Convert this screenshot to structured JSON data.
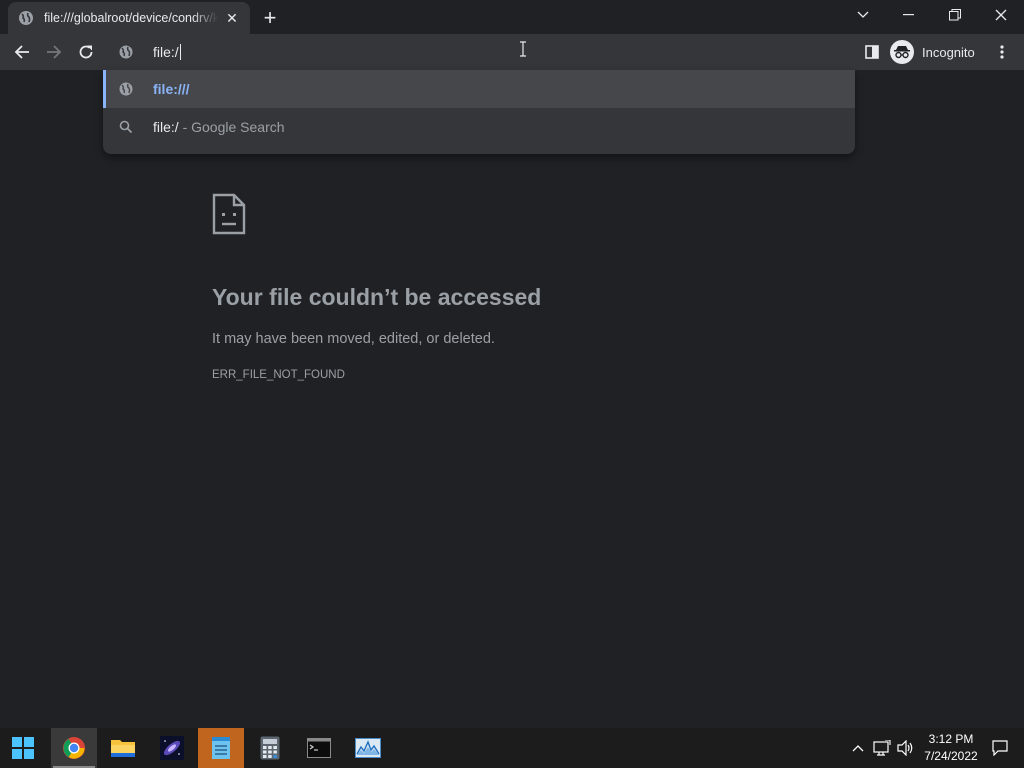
{
  "browser": {
    "tab": {
      "title": "file:///globalroot/device/condrv/kernelconnect"
    },
    "new_tab_symbol": "+",
    "omnibox": {
      "value": "file:/"
    },
    "incognito_label": "Incognito",
    "suggestions": [
      {
        "icon": "globe-icon",
        "main": "file:///",
        "sub": "",
        "selected": true
      },
      {
        "icon": "search-icon",
        "main": "file:/",
        "sub": " - Google Search",
        "selected": false
      }
    ]
  },
  "error_page": {
    "title": "Your file couldn’t be accessed",
    "description": "It may have been moved, edited, or deleted.",
    "code": "ERR_FILE_NOT_FOUND"
  },
  "taskbar": {
    "apps": [
      "start-icon",
      "chrome-icon",
      "file-explorer-icon",
      "galaxy-app-icon",
      "notepad-icon",
      "calculator-icon",
      "terminal-icon",
      "performance-monitor-icon"
    ],
    "time": "3:12 PM",
    "date": "7/24/2022"
  },
  "colors": {
    "background": "#202124",
    "toolbar": "#35363a",
    "accent": "#8ab4f8",
    "muted_text": "#9aa0a6"
  }
}
